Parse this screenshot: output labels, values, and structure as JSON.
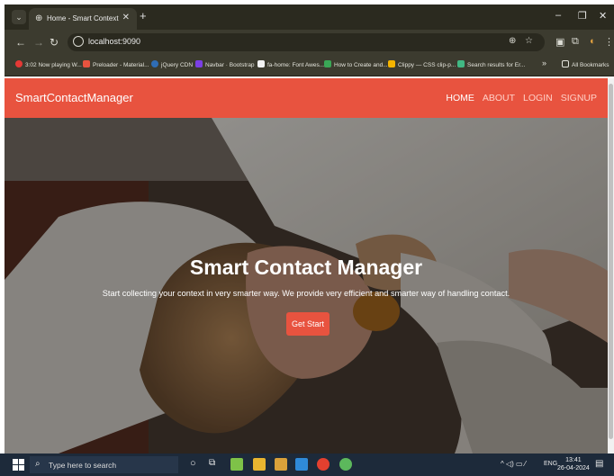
{
  "browser": {
    "tab_title": "Home - Smart Context",
    "url": "localhost:9090",
    "bookmarks": [
      "3:02 Now playing W...",
      "Preloader - Material...",
      "jQuery CDN",
      "Navbar · Bootstrap",
      "fa-home: Font Awes...",
      "How to Create and...",
      "Clippy — CSS clip-p...",
      "Search results for Er...",
      "All Bookmarks"
    ]
  },
  "navbar": {
    "brand": "SmartContactManager",
    "links": [
      "HOME",
      "ABOUT",
      "LOGIN",
      "SIGNUP"
    ],
    "color": "#e8533f"
  },
  "hero": {
    "title": "Smart Contact Manager",
    "subtitle": "Start collecting your context in very smarter way. We provide very efficient and smarter way of handling contact.",
    "button": "Get Start"
  },
  "taskbar": {
    "search_placeholder": "Type here to search",
    "language": "ENG",
    "time": "13:41",
    "date": "26-04-2024"
  }
}
